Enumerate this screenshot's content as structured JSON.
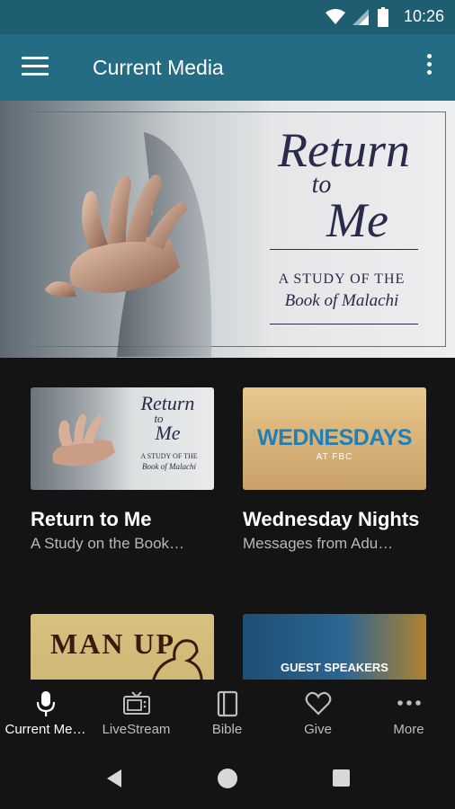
{
  "status_bar": {
    "time": "10:26"
  },
  "app_bar": {
    "title": "Current Media"
  },
  "hero": {
    "title_line1": "Return",
    "title_line2": "to",
    "title_line3": "Me",
    "subtitle_line1": "A STUDY OF THE",
    "subtitle_line2": "Book of Malachi",
    "slide_count": 5,
    "active_slide": 1
  },
  "cards": [
    {
      "title": "Return to Me",
      "subtitle": "A Study on the Book…",
      "thumb_text": {
        "line1": "Return",
        "line2": "to",
        "line3": "Me",
        "sub1": "A STUDY OF THE",
        "sub2": "Book of Malachi"
      }
    },
    {
      "title": "Wednesday Nights",
      "subtitle": "Messages from Adu…",
      "thumb_text": {
        "main": "WEDNESDAYS",
        "sub": "AT FBC"
      }
    },
    {
      "thumb_text": {
        "main": "MAN UP"
      }
    },
    {
      "thumb_text": {
        "main": "GUEST SPEAKERS"
      }
    }
  ],
  "bottom_nav": [
    {
      "label": "Current Me…",
      "icon": "mic-icon",
      "active": true
    },
    {
      "label": "LiveStream",
      "icon": "tv-icon",
      "active": false
    },
    {
      "label": "Bible",
      "icon": "book-icon",
      "active": false
    },
    {
      "label": "Give",
      "icon": "heart-icon",
      "active": false
    },
    {
      "label": "More",
      "icon": "more-horizontal-icon",
      "active": false
    }
  ],
  "colors": {
    "status_bar": "#1f5d71",
    "app_bar": "#246c84",
    "background": "#141414",
    "title_ink": "#2c2a4a",
    "wednesday_blue": "#1f7fb6"
  }
}
